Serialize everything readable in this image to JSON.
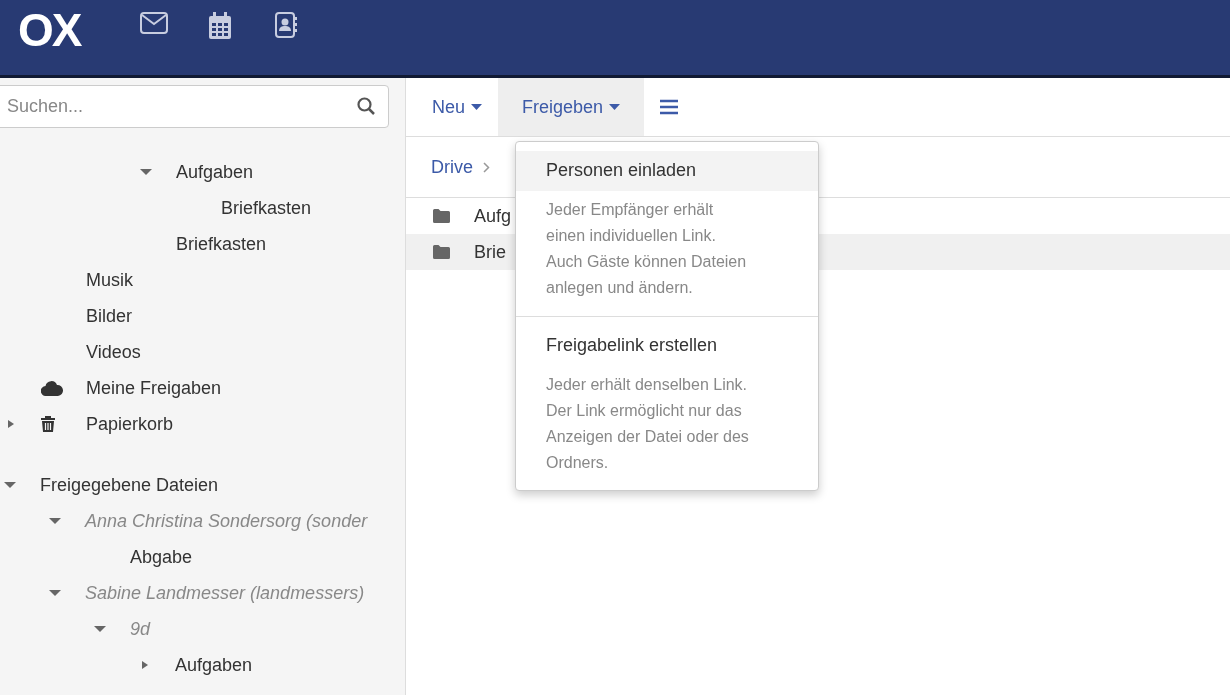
{
  "header": {
    "logo": "OX",
    "apps": [
      {
        "kind": "mail"
      },
      {
        "kind": "calendar"
      },
      {
        "kind": "contacts"
      }
    ]
  },
  "sidebar": {
    "search": {
      "placeholder": "Suchen..."
    },
    "sections": [
      {
        "kind": "deep",
        "items": [
          {
            "label": "Aufgaben",
            "kind": "folder",
            "expanded": true,
            "children": [
              {
                "label": "Briefkasten",
                "kind": "folder"
              }
            ]
          },
          {
            "label": "Briefkasten",
            "kind": "folder"
          }
        ]
      },
      {
        "kind": "mid",
        "items": [
          {
            "label": "Musik",
            "kind": "folder"
          },
          {
            "label": "Bilder",
            "kind": "folder"
          },
          {
            "label": "Videos",
            "kind": "folder"
          },
          {
            "label": "Meine Freigaben",
            "kind": "shares"
          },
          {
            "label": "Papierkorb",
            "kind": "trash",
            "expanded": false
          }
        ]
      },
      {
        "kind": "top",
        "items": [
          {
            "label": "Freigegebene Dateien",
            "kind": "folder",
            "expanded": true,
            "children": [
              {
                "label": "Anna Christina Sondersorg (sonder",
                "kind": "user",
                "expanded": true,
                "children": [
                  {
                    "label": "Abgabe",
                    "kind": "folder"
                  }
                ]
              },
              {
                "label": "Sabine Landmesser (landmessers)",
                "kind": "user",
                "expanded": true,
                "children": [
                  {
                    "label": "9d",
                    "kind": "user",
                    "expanded": true,
                    "children": [
                      {
                        "label": "Aufgaben",
                        "kind": "folder",
                        "expanded": false
                      }
                    ]
                  }
                ]
              }
            ]
          }
        ]
      }
    ]
  },
  "toolbar": [
    {
      "label": "Neu",
      "kind": "dropdown",
      "open": false
    },
    {
      "label": "Freigeben",
      "kind": "dropdown",
      "open": true
    },
    {
      "kind": "menu"
    }
  ],
  "breadcrumb": [
    {
      "label": "Drive"
    }
  ],
  "files": [
    {
      "name": "Aufg",
      "highlighted": false
    },
    {
      "name": "Brie",
      "highlighted": true
    }
  ],
  "share_menu": [
    {
      "title": "Personen einladen",
      "description": "Jeder Empfänger erhält einen individuellen Link. Auch Gäste können Dateien anlegen und ändern.",
      "highlighted": true
    },
    {
      "title": "Freigabelink erstellen",
      "description": "Jeder erhält denselben Link. Der Link ermöglicht nur das Anzeigen der Datei oder des Ordners.",
      "highlighted": false
    }
  ]
}
